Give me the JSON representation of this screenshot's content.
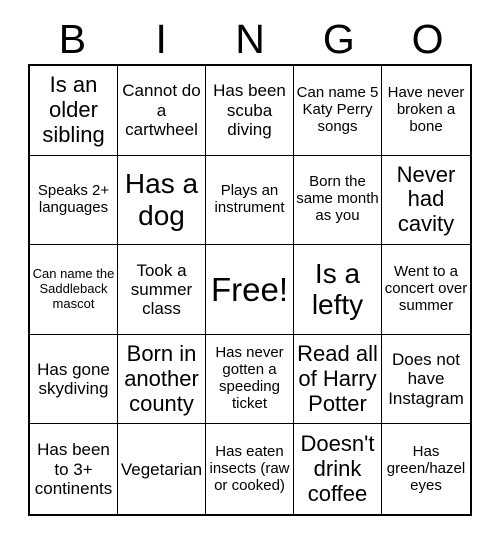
{
  "card": {
    "header_letters": [
      "B",
      "I",
      "N",
      "G",
      "O"
    ],
    "columns": 5,
    "rows": 5,
    "border_color": "#000000",
    "background_color": "#ffffff",
    "text_color": "#000000",
    "cells": [
      {
        "text": "Is an older sibling",
        "size": "l"
      },
      {
        "text": "Cannot do a cartwheel",
        "size": "m"
      },
      {
        "text": "Has been scuba diving",
        "size": "m"
      },
      {
        "text": "Can name 5 Katy Perry songs",
        "size": "s"
      },
      {
        "text": "Have never broken a bone",
        "size": "s"
      },
      {
        "text": "Speaks 2+ languages",
        "size": "s"
      },
      {
        "text": "Has a dog",
        "size": "xl"
      },
      {
        "text": "Plays an instrument",
        "size": "s"
      },
      {
        "text": "Born the same month as you",
        "size": "s"
      },
      {
        "text": "Never had cavity",
        "size": "l"
      },
      {
        "text": "Can name the Saddleback mascot",
        "size": "xs"
      },
      {
        "text": "Took a summer class",
        "size": "m"
      },
      {
        "text": "Free!",
        "size": "xxl"
      },
      {
        "text": "Is a lefty",
        "size": "xl"
      },
      {
        "text": "Went to a concert over summer",
        "size": "s"
      },
      {
        "text": "Has gone skydiving",
        "size": "m"
      },
      {
        "text": "Born in another county",
        "size": "l"
      },
      {
        "text": "Has never gotten a speeding ticket",
        "size": "s"
      },
      {
        "text": "Read all of Harry Potter",
        "size": "l"
      },
      {
        "text": "Does not have Instagram",
        "size": "m"
      },
      {
        "text": "Has been to 3+ continents",
        "size": "m"
      },
      {
        "text": "Vegetarian",
        "size": "m"
      },
      {
        "text": "Has eaten insects (raw or cooked)",
        "size": "s"
      },
      {
        "text": "Doesn't drink coffee",
        "size": "l"
      },
      {
        "text": "Has green/hazel eyes",
        "size": "s"
      }
    ]
  }
}
